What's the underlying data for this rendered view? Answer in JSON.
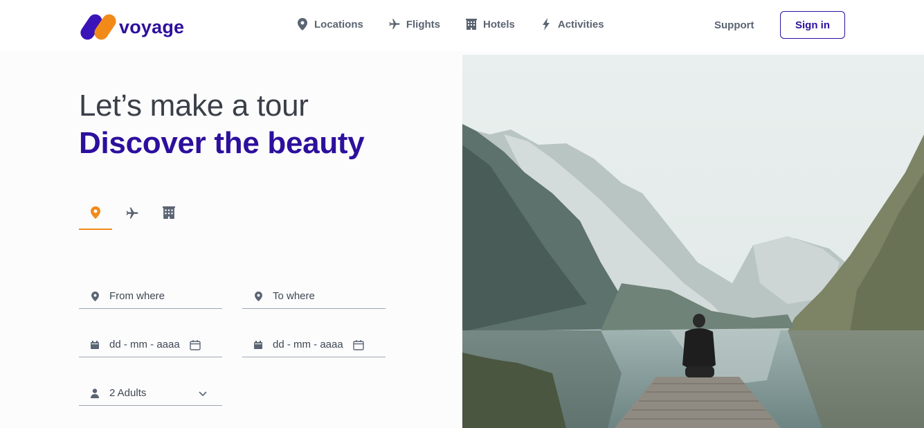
{
  "brand": {
    "name": "voyage",
    "colors": {
      "primary": "#2d0f9d",
      "accent": "#f28a1a"
    }
  },
  "nav": {
    "items": [
      {
        "label": "Locations",
        "icon": "map-pin-icon"
      },
      {
        "label": "Flights",
        "icon": "airplane-icon"
      },
      {
        "label": "Hotels",
        "icon": "building-icon"
      },
      {
        "label": "Activities",
        "icon": "lightning-icon"
      }
    ],
    "support_label": "Support",
    "signin_label": "Sign in"
  },
  "hero": {
    "line1": "Let’s make a tour",
    "line2": "Discover the beauty"
  },
  "search": {
    "tabs": [
      {
        "icon": "map-pin-icon",
        "active": true
      },
      {
        "icon": "airplane-icon",
        "active": false
      },
      {
        "icon": "building-icon",
        "active": false
      }
    ],
    "from_placeholder": "From where",
    "to_placeholder": "To where",
    "date_from_placeholder": "dd - mm - aaaa",
    "date_to_placeholder": "dd - mm - aaaa",
    "guests_value": "2 Adults"
  }
}
